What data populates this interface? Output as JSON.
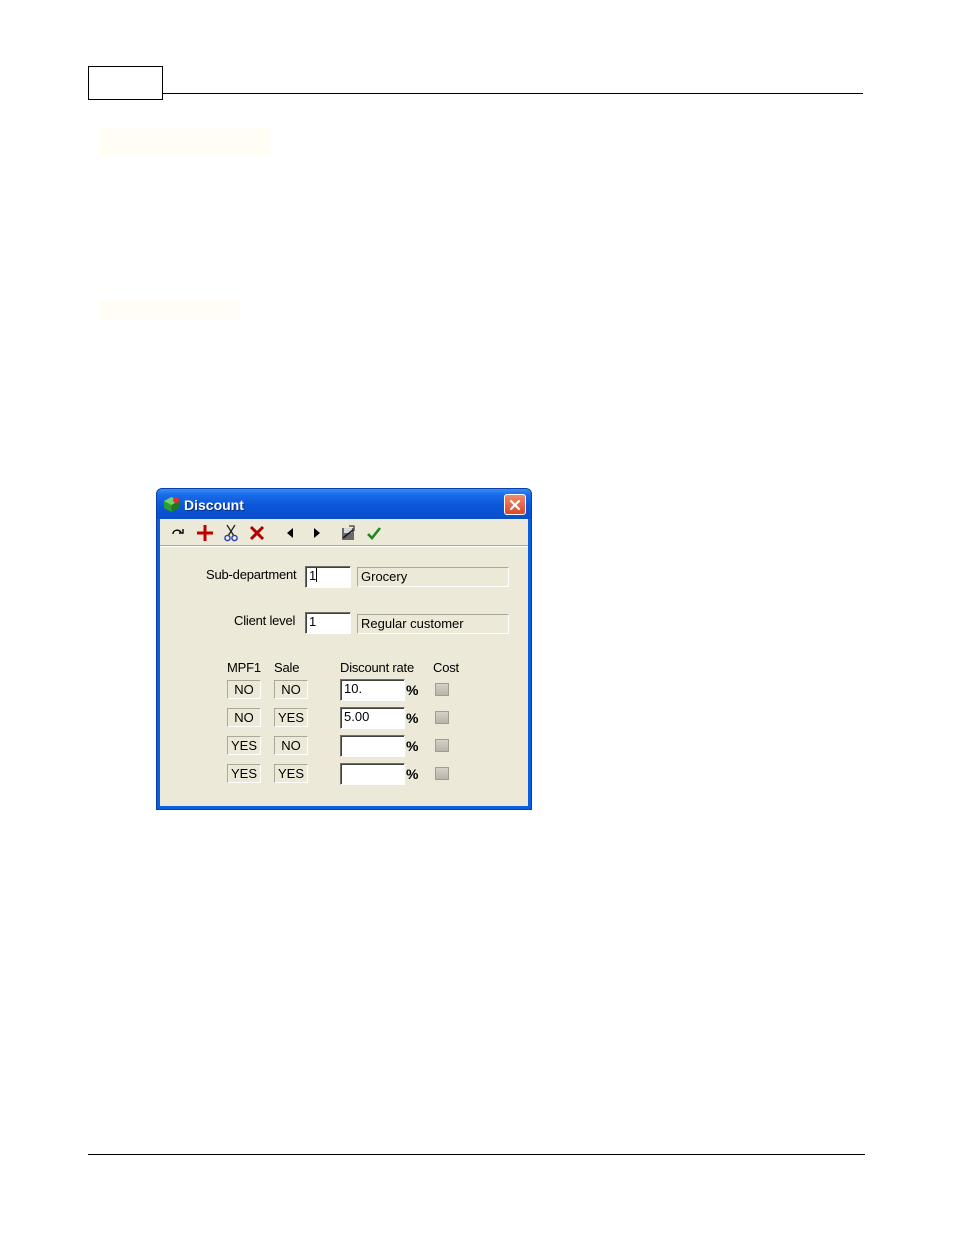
{
  "window": {
    "title": "Discount",
    "toolbar": [
      {
        "name": "refresh-icon"
      },
      {
        "name": "add-icon"
      },
      {
        "name": "cut-icon"
      },
      {
        "name": "delete-icon"
      },
      {
        "name": "previous-icon"
      },
      {
        "name": "next-icon"
      },
      {
        "name": "save-icon"
      },
      {
        "name": "confirm-icon"
      }
    ]
  },
  "form": {
    "subdepartment": {
      "label": "Sub-department",
      "value": "1",
      "description": "Grocery"
    },
    "client_level": {
      "label": "Client level",
      "value": "1",
      "description": "Regular customer"
    },
    "headers": {
      "mpf1": "MPF1",
      "sale": "Sale",
      "discount_rate": "Discount rate",
      "cost": "Cost"
    },
    "percent_symbol": "%",
    "rows": [
      {
        "mpf1": "NO",
        "sale": "NO",
        "rate": "10.",
        "cost": false
      },
      {
        "mpf1": "NO",
        "sale": "YES",
        "rate": "5.00",
        "cost": false
      },
      {
        "mpf1": "YES",
        "sale": "NO",
        "rate": "",
        "cost": false
      },
      {
        "mpf1": "YES",
        "sale": "YES",
        "rate": "",
        "cost": false
      }
    ]
  }
}
